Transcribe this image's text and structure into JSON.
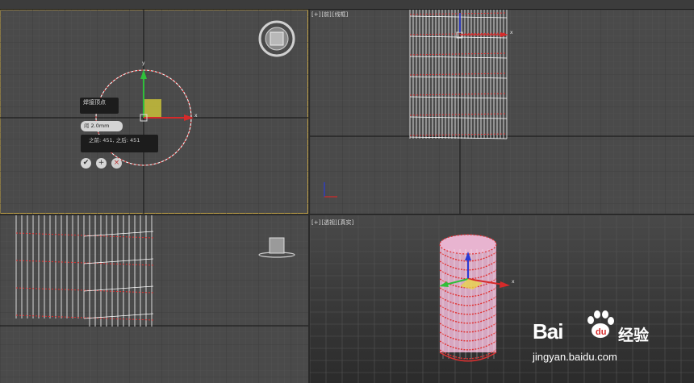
{
  "viewports": {
    "top_right_label": [
      "[+]",
      "[前]",
      "[线框]"
    ],
    "bottom_right_label": [
      "[+]",
      "[透视]",
      "[真实]"
    ]
  },
  "caddy": {
    "title": "焊接顶点",
    "field_label": "阈",
    "field_value": "2.0mm",
    "info_text": "之前: 451, 之后: 451",
    "ok_glyph": "✔",
    "apply_glyph": "+",
    "cancel_glyph": "×"
  },
  "gizmo": {
    "x_label": "x",
    "y_label": "y"
  },
  "watermark": {
    "brand": "Bai",
    "brand_suffix": "经验",
    "url": "jingyan.baidu.com"
  },
  "colors": {
    "viewport_bg": "#4a4a4a",
    "wire_white": "#ffffff",
    "wire_red": "#e03030",
    "pink_surface": "#e8b4d0",
    "axis_green": "#2fbf3a",
    "axis_red": "#d62a2a",
    "axis_blue": "#2a3ad6",
    "active_border": "#c8a84a"
  },
  "icons": [
    "view-cube-icon",
    "check-icon",
    "plus-icon",
    "close-icon",
    "baidu-paw-icon"
  ]
}
